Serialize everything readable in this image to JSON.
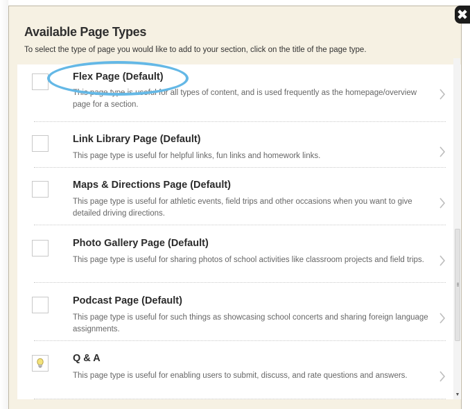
{
  "dialog": {
    "title": "Available Page Types",
    "subtitle": "To select the type of page you would like to add to your section, click on the title of the page type.",
    "close_label": "✖"
  },
  "page_types": [
    {
      "title": "Flex Page (Default)",
      "description": "This page type is useful for all types of content, and is used frequently as the homepage/overview page for a section.",
      "icon": "empty-box-icon"
    },
    {
      "title": "Link Library Page (Default)",
      "description": "This page type is useful for helpful links, fun links and homework links.",
      "icon": "empty-box-icon"
    },
    {
      "title": "Maps & Directions Page (Default)",
      "description": "This page type is useful for athletic events, field trips and other occasions when you want to give detailed driving directions.",
      "icon": "empty-box-icon"
    },
    {
      "title": "Photo Gallery Page (Default)",
      "description": "This page type is useful for sharing photos of school activities like classroom projects and field trips.",
      "icon": "empty-box-icon"
    },
    {
      "title": "Podcast Page (Default)",
      "description": "This page type is useful for such things as showcasing school concerts and sharing foreign language assignments.",
      "icon": "empty-box-icon"
    },
    {
      "title": "Q & A",
      "description": "This page type is useful for enabling users to submit, discuss, and rate questions and answers.",
      "icon": "lightbulb-icon"
    }
  ],
  "colors": {
    "header_bg": "#f6f1e3",
    "highlight": "#64b8e6",
    "title_text": "#2b2b2b",
    "description_text": "#666666"
  }
}
